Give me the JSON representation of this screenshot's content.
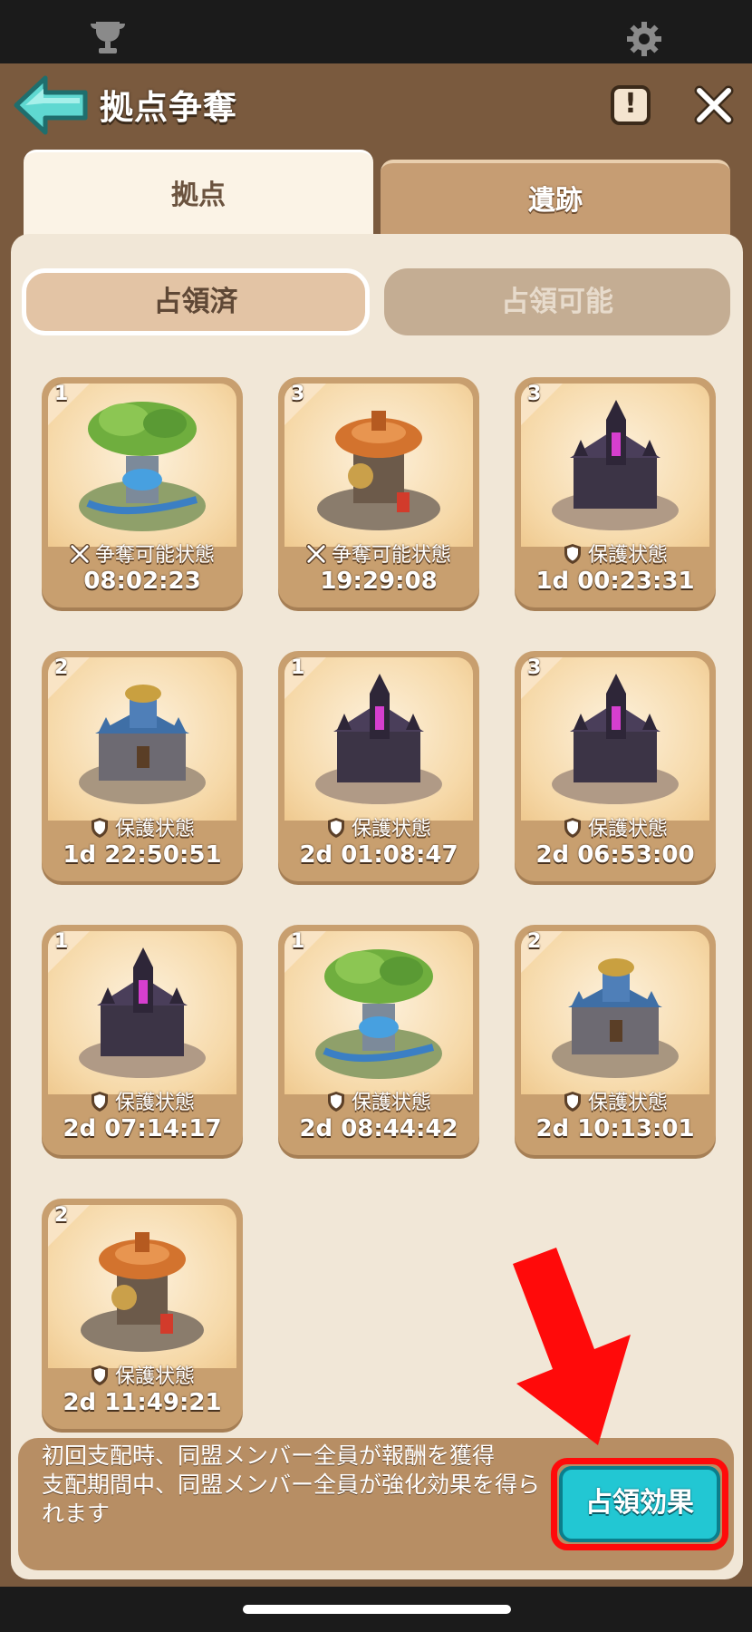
{
  "header": {
    "title": "拠点争奪",
    "info_label": "!"
  },
  "tabs": [
    {
      "label": "拠点",
      "active": true
    },
    {
      "label": "遺跡",
      "active": false
    }
  ],
  "subtabs": [
    {
      "label": "占領済",
      "active": true
    },
    {
      "label": "占領可能",
      "active": false
    }
  ],
  "cards": [
    {
      "level": "1",
      "status": "争奪可能状態",
      "status_icon": "crossed-swords-icon",
      "timer": "08:02:23",
      "art": "tree-fountain"
    },
    {
      "level": "3",
      "status": "争奪可能状態",
      "status_icon": "crossed-swords-icon",
      "timer": "19:29:08",
      "art": "mushroom-forge"
    },
    {
      "level": "3",
      "status": "保護状態",
      "status_icon": "shield-icon",
      "timer": "1d 00:23:31",
      "art": "dark-castle"
    },
    {
      "level": "2",
      "status": "保護状態",
      "status_icon": "shield-icon",
      "timer": "1d 22:50:51",
      "art": "blue-castle"
    },
    {
      "level": "1",
      "status": "保護状態",
      "status_icon": "shield-icon",
      "timer": "2d 01:08:47",
      "art": "dark-castle"
    },
    {
      "level": "3",
      "status": "保護状態",
      "status_icon": "shield-icon",
      "timer": "2d 06:53:00",
      "art": "dark-castle"
    },
    {
      "level": "1",
      "status": "保護状態",
      "status_icon": "shield-icon",
      "timer": "2d 07:14:17",
      "art": "dark-castle"
    },
    {
      "level": "1",
      "status": "保護状態",
      "status_icon": "shield-icon",
      "timer": "2d 08:44:42",
      "art": "tree-fountain"
    },
    {
      "level": "2",
      "status": "保護状態",
      "status_icon": "shield-icon",
      "timer": "2d 10:13:01",
      "art": "blue-castle"
    },
    {
      "level": "2",
      "status": "保護状態",
      "status_icon": "shield-icon",
      "timer": "2d 11:49:21",
      "art": "mushroom-forge"
    }
  ],
  "bottom": {
    "line1": "初回支配時、同盟メンバー全員が報酬を獲得",
    "line2": "支配期間中、同盟メンバー全員が強化効果を得られます",
    "button_label": "占領効果"
  },
  "colors": {
    "accent_button": "#22c7d3",
    "highlight_outline": "#ff0a0a",
    "frame": "#7a5a3e"
  }
}
